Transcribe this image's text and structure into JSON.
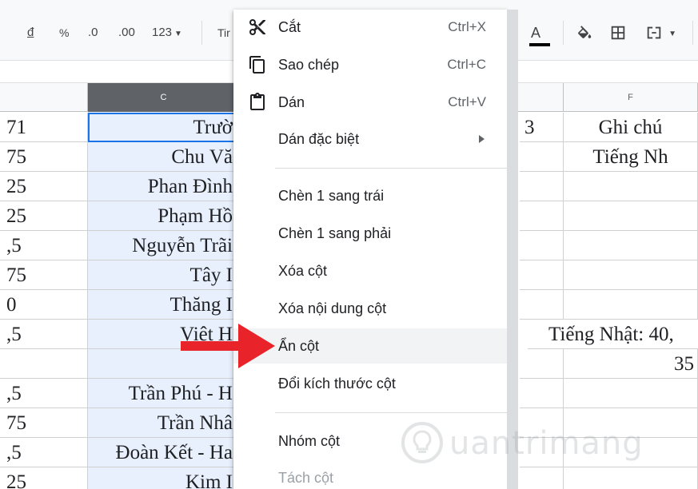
{
  "toolbar": {
    "currency": "đ",
    "percent": "%",
    "decrease_decimal": ".0",
    "increase_decimal": ".00",
    "format_more": "123",
    "font_name_partial": "Tir",
    "font_color_letter": "A"
  },
  "columns": {
    "c": "C",
    "f": "F"
  },
  "rows": [
    {
      "b": "71",
      "c": "Trườ",
      "e": "3",
      "f": "Ghi chú"
    },
    {
      "b": "75",
      "c": "Chu Vă",
      "e": "",
      "f": "Tiếng Nh"
    },
    {
      "b": "25",
      "c": "Phan Đình",
      "e": "",
      "f": ""
    },
    {
      "b": "25",
      "c": "Phạm Hồ",
      "e": "",
      "f": ""
    },
    {
      "b": ",5",
      "c": "Nguyễn Trãi",
      "e": "",
      "f": ""
    },
    {
      "b": "75",
      "c": "Tây I",
      "e": "",
      "f": ""
    },
    {
      "b": "0",
      "c": "Thăng I",
      "e": "",
      "f": ""
    },
    {
      "b": ",5",
      "c": "Việt H",
      "e": "",
      "f": "Tiếng Nhật: 40,"
    },
    {
      "b": "",
      "c": "",
      "e": "",
      "f": "35"
    },
    {
      "b": ",5",
      "c": "Trần Phú - H",
      "e": "",
      "f": ""
    },
    {
      "b": "75",
      "c": "Trần Nhâ",
      "e": "",
      "f": ""
    },
    {
      "b": ",5",
      "c": "Đoàn Kết - Ha",
      "e": "",
      "f": ""
    },
    {
      "b": "25",
      "c": "Kim I",
      "e": "",
      "f": ""
    }
  ],
  "menu": {
    "cut": {
      "label": "Cắt",
      "shortcut": "Ctrl+X"
    },
    "copy": {
      "label": "Sao chép",
      "shortcut": "Ctrl+C"
    },
    "paste": {
      "label": "Dán",
      "shortcut": "Ctrl+V"
    },
    "paste_special": {
      "label": "Dán đặc biệt"
    },
    "insert_left": {
      "label": "Chèn 1 sang trái"
    },
    "insert_right": {
      "label": "Chèn 1 sang phải"
    },
    "delete_column": {
      "label": "Xóa cột"
    },
    "clear_column": {
      "label": "Xóa nội dung cột"
    },
    "hide_column": {
      "label": "Ẩn cột"
    },
    "resize_column": {
      "label": "Đổi kích thước cột"
    },
    "group_column": {
      "label": "Nhóm cột"
    },
    "ungroup_column": {
      "label": "Tách cột"
    }
  },
  "watermark": {
    "text": "uantrimang"
  },
  "colors": {
    "arrow": "#e8232a",
    "selection": "#1a73e8",
    "header_selected": "#5f6368"
  }
}
